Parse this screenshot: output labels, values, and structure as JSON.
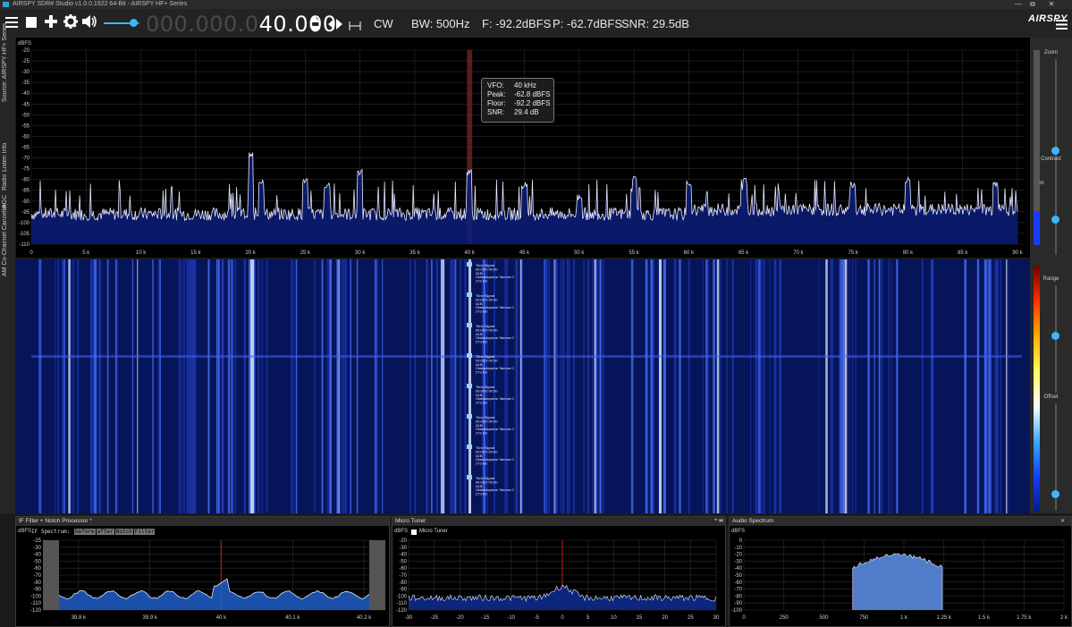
{
  "window": {
    "title": "AIRSPY SDR# Studio v1.0.0.1922 64-Bit - AIRSPY HF+ Series",
    "min": "—",
    "max": "□",
    "restore": "⧉",
    "close": "✕"
  },
  "toolbar": {
    "menu_icon": "menu-icon",
    "stop_icon": "stop-icon",
    "add_icon": "plus-icon",
    "settings_icon": "gear-icon",
    "volume_icon": "speaker-icon",
    "volume_level": 0.82,
    "freq_dim": "000.000.0",
    "freq_lit": "40.000",
    "mode": "CW",
    "bw": "BW: 500Hz",
    "floor": "F: -92.2dBFS",
    "peak": "P: -62.7dBFS",
    "snr": "SNR: 29.5dB",
    "logo": "AIRSPY",
    "menu_right_icon": "hamburger-icon"
  },
  "sidebar": {
    "tabs": [
      "Source: AIRSPY HF+ Series",
      "Listen Info",
      "Radio",
      "AGC",
      "AM Co-Channel Canceller"
    ]
  },
  "right_panel": {
    "zoom": "Zoom",
    "contrast": "Contrast",
    "range": "Range",
    "offset": "Offset",
    "side_value": "30"
  },
  "spectrum": {
    "unit": "dBFS",
    "y_ticks": [
      "-20",
      "-25",
      "-30",
      "-35",
      "-40",
      "-45",
      "-50",
      "-55",
      "-60",
      "-65",
      "-70",
      "-75",
      "-80",
      "-85",
      "-90",
      "-95",
      "-100",
      "-105",
      "-110"
    ],
    "x_ticks": [
      "0",
      "5 k",
      "10 k",
      "15 k",
      "20 k",
      "25 k",
      "30 k",
      "35 k",
      "40 k",
      "45 k",
      "50 k",
      "55 k",
      "60 k",
      "65 k",
      "70 k",
      "75 k",
      "80 k",
      "85 k",
      "90 k"
    ],
    "tooltip": {
      "vfo_k": "VFO:",
      "vfo_v": "40 kHz",
      "peak_k": "Peak:",
      "peak_v": "-62.8 dBFS",
      "floor_k": "Floor:",
      "floor_v": "-92.2 dBFS",
      "snr_k": "SNR:",
      "snr_v": "29.4 dB"
    }
  },
  "waterfall": {
    "labels": [
      "Time Signal",
      "00:00:0 00:00",
      "A1B",
      "Otakadoyama Tamura C",
      "273 km"
    ]
  },
  "if_panel": {
    "title": "IF Filter + Notch Processor *",
    "unit": "dBFS",
    "spectrum_label": "IF Spectrum:",
    "chips": [
      "before",
      "after",
      "Notch",
      "Filter"
    ],
    "y_ticks": [
      "-25",
      "-30",
      "-40",
      "-50",
      "-60",
      "-70",
      "-80",
      "-90",
      "-100",
      "-110",
      "-120"
    ],
    "x_ticks": [
      "39.8 k",
      "39.9 k",
      "40 k",
      "40.1 k",
      "40.2 k"
    ]
  },
  "micro_panel": {
    "title": "Micro Tuner",
    "unit": "dBFS",
    "checkbox_label": "Micro Tuner",
    "y_ticks": [
      "-20",
      "-30",
      "-40",
      "-50",
      "-60",
      "-70",
      "-80",
      "-90",
      "-100",
      "-110",
      "-120"
    ],
    "x_ticks": [
      "-30",
      "-25",
      "-20",
      "-15",
      "-10",
      "-5",
      "0",
      "5",
      "10",
      "15",
      "20",
      "25",
      "30"
    ]
  },
  "audio_panel": {
    "title": "Audio Spectrum",
    "unit": "dBFS",
    "y_ticks": [
      "0",
      "-10",
      "-20",
      "-30",
      "-40",
      "-50",
      "-60",
      "-70",
      "-80",
      "-90",
      "-100"
    ],
    "x_ticks": [
      "0",
      "250",
      "500",
      "750",
      "1 k",
      "1.25 k",
      "1.5 k",
      "1.75 k",
      "2 k"
    ]
  }
}
